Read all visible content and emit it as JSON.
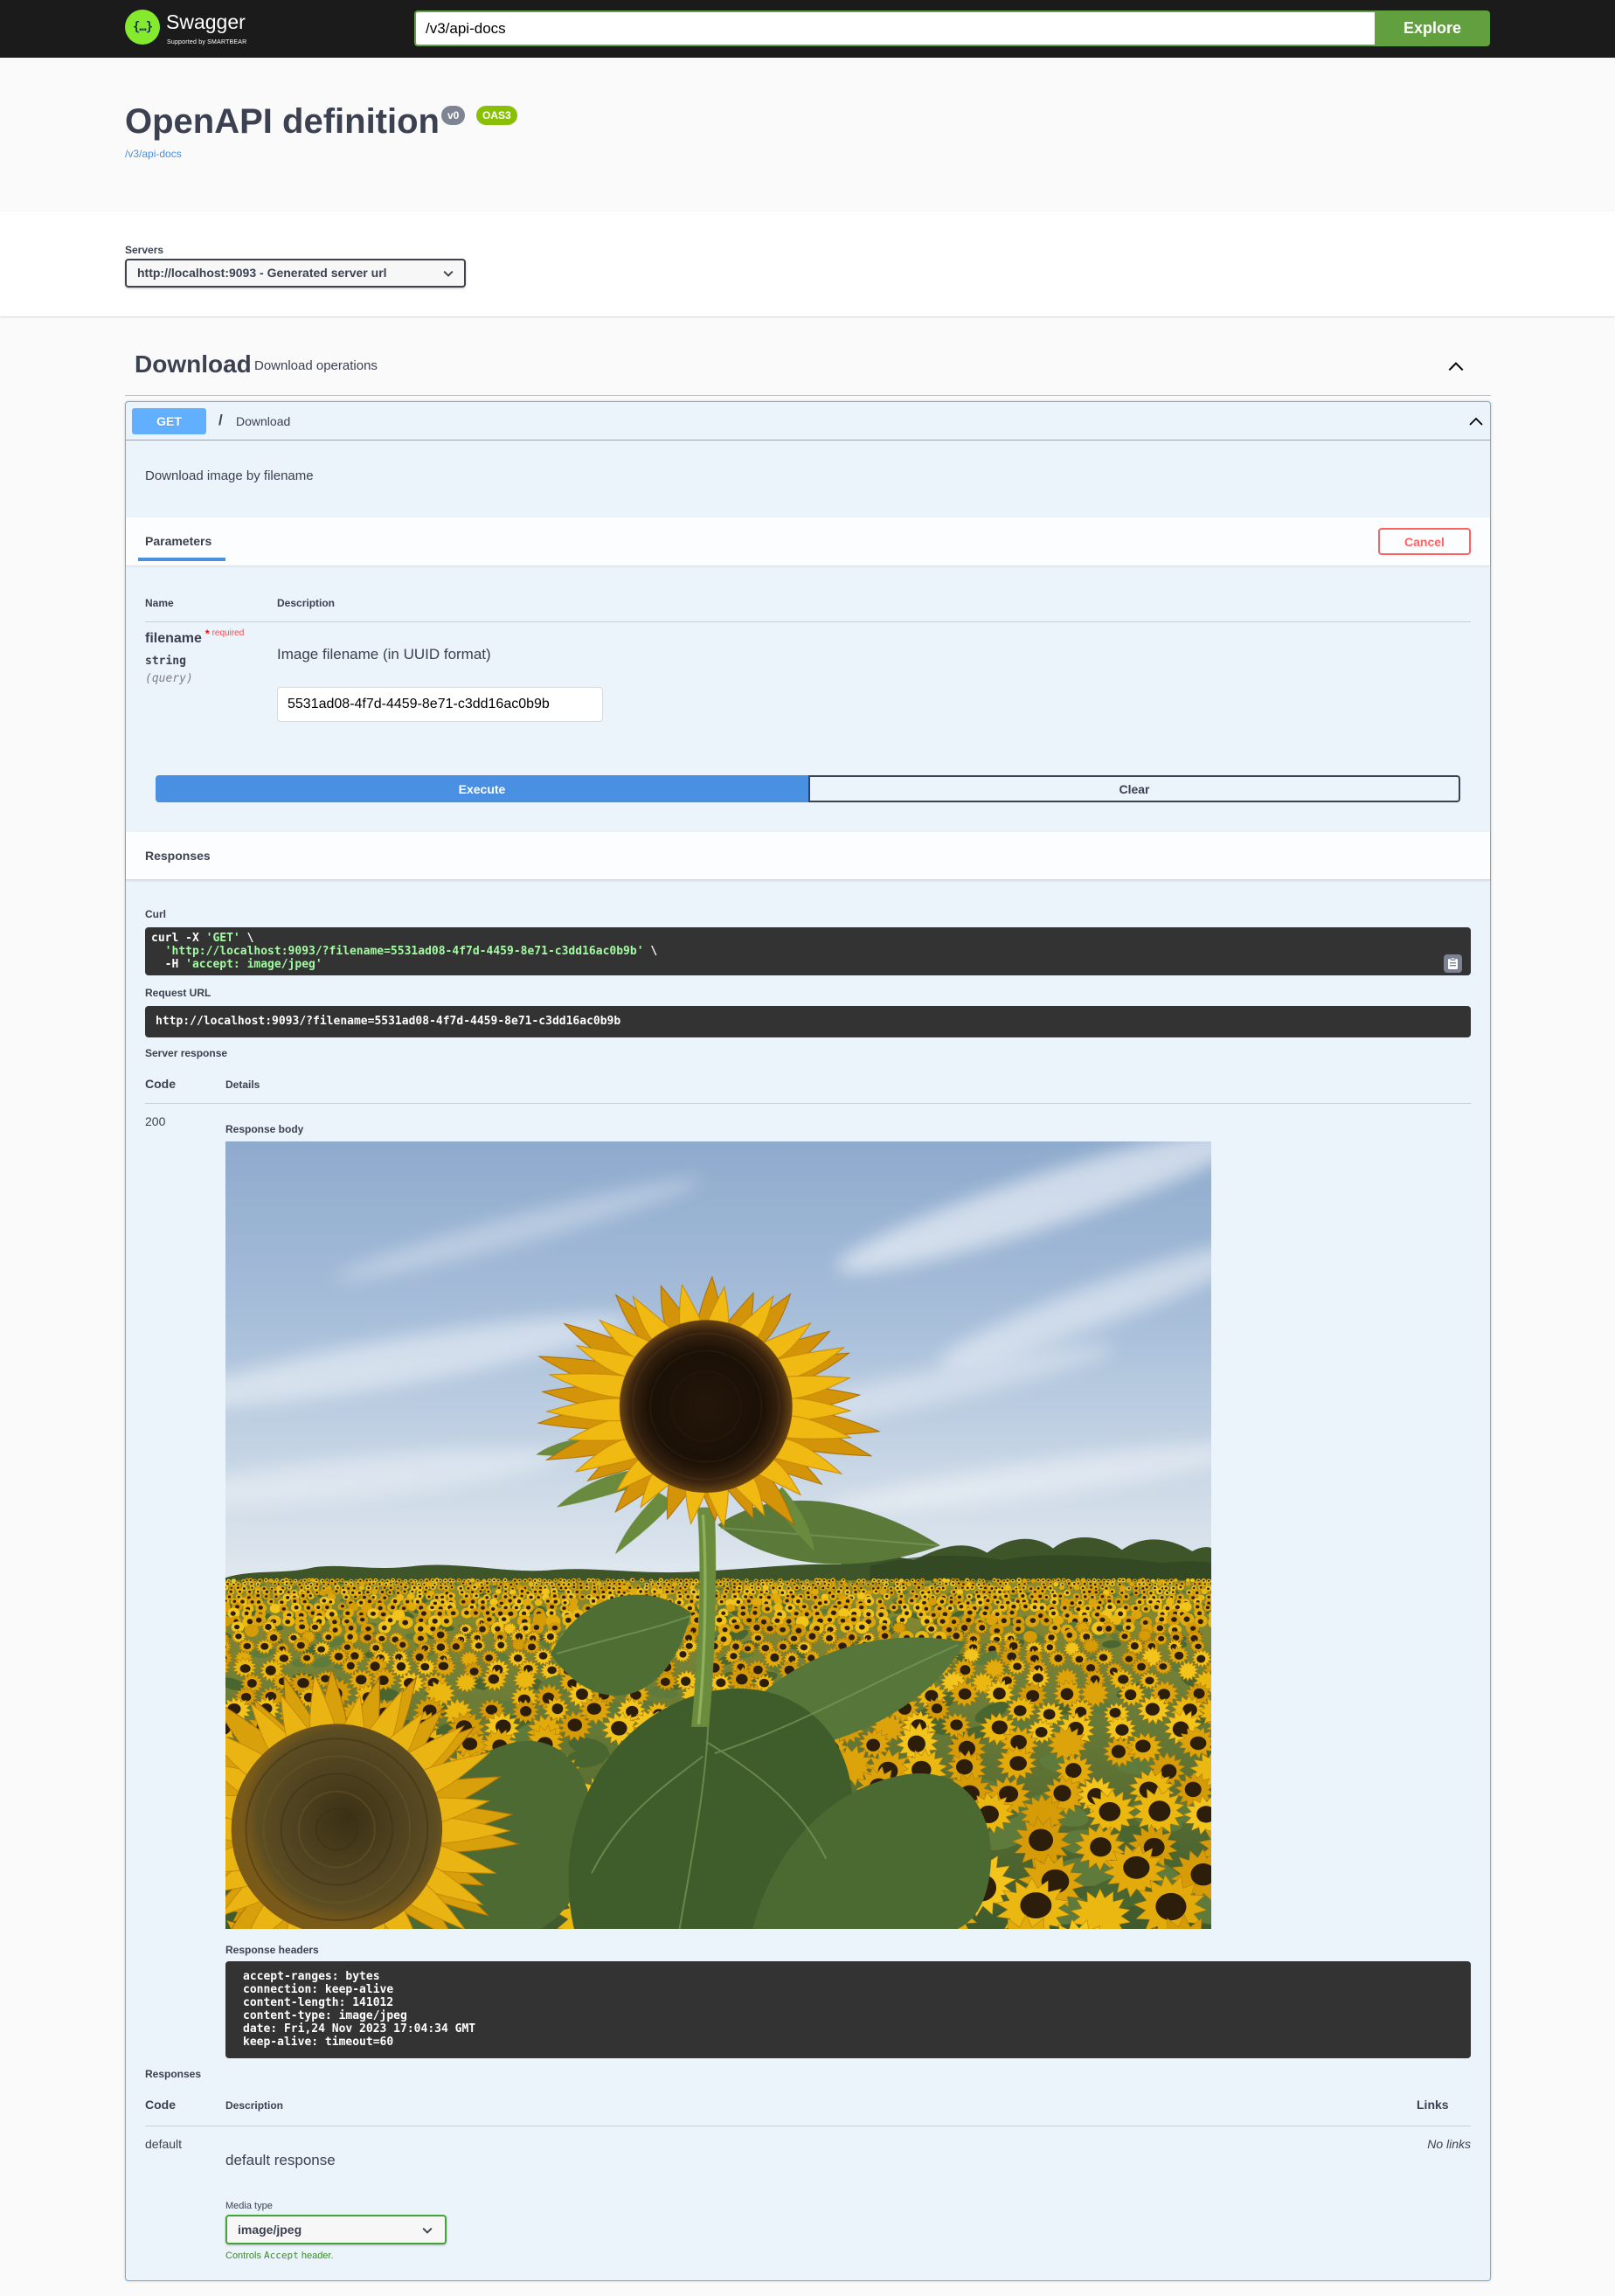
{
  "theme": {
    "topbar_bg": "#1b1b1b",
    "brand_green": "#85ea2d",
    "explore": "#62a03f",
    "get": "#61affe",
    "execute": "#4990e2",
    "cancel": "#ff6060",
    "media_select_border": "#41a53a"
  },
  "topbar": {
    "logo_glyph": "{…}",
    "brand": "Swagger",
    "brand_sub": "Supported by SMARTBEAR",
    "search_value": "/v3/api-docs",
    "explore_label": "Explore"
  },
  "info": {
    "title": "OpenAPI definition",
    "version_badge": "v0",
    "oas_badge": "OAS3",
    "spec_link": "/v3/api-docs"
  },
  "servers": {
    "label": "Servers",
    "selected": "http://localhost:9093 - Generated server url"
  },
  "tag": {
    "name": "Download",
    "description": "Download operations",
    "toggle_icon": "chevron-up-icon"
  },
  "operation": {
    "method": "GET",
    "path": "/",
    "summary": "Download",
    "toggle_icon": "chevron-up-icon",
    "description": "Download image by filename",
    "parameters_tab": "Parameters",
    "cancel_label": "Cancel",
    "param_table": {
      "name_header": "Name",
      "description_header": "Description"
    },
    "parameter": {
      "name": "filename",
      "required_mark": "*",
      "required_label": "required",
      "type": "string",
      "location": "(query)",
      "description": "Image filename (in UUID format)",
      "value": "5531ad08-4f7d-4459-8e71-c3dd16ac0b9b"
    },
    "execute_label": "Execute",
    "clear_label": "Clear",
    "responses_title": "Responses",
    "curl": {
      "label": "Curl",
      "line1": {
        "cmd": "curl -X ",
        "str": "'GET'",
        "tail": " \\"
      },
      "line2": {
        "cmd": "  ",
        "str": "'http://localhost:9093/?filename=5531ad08-4f7d-4459-8e71-c3dd16ac0b9b'",
        "tail": " \\"
      },
      "line3": {
        "cmd": "  -H ",
        "str": "'accept: image/jpeg'"
      },
      "copy_icon": "copy-to-clipboard-icon"
    },
    "request_url": {
      "label": "Request URL",
      "value": "http://localhost:9093/?filename=5531ad08-4f7d-4459-8e71-c3dd16ac0b9b"
    },
    "server_response": {
      "label": "Server response",
      "code_header": "Code",
      "details_header": "Details",
      "code": "200",
      "body_label": "Response body",
      "body_content": "sunflower-field-photo",
      "headers_label": "Response headers",
      "headers": [
        "accept-ranges: bytes",
        "connection: keep-alive",
        "content-length: 141012",
        "content-type: image/jpeg",
        "date: Fri,24 Nov 2023 17:04:34 GMT",
        "keep-alive: timeout=60"
      ]
    },
    "responses": {
      "label": "Responses",
      "code_header": "Code",
      "description_header": "Description",
      "links_header": "Links",
      "rows": [
        {
          "code": "default",
          "description": "default response",
          "links": "No links"
        }
      ],
      "media_type_label": "Media type",
      "media_type": "image/jpeg",
      "controls_prefix": "Controls ",
      "controls_code": "Accept",
      "controls_suffix": " header."
    }
  }
}
